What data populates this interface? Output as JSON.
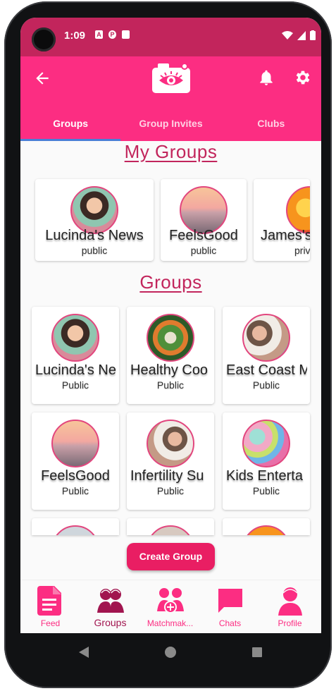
{
  "status_bar": {
    "time": "1:09",
    "icons": [
      "A",
      "P",
      "sd"
    ]
  },
  "app_bar": {
    "tabs": [
      {
        "label": "Groups",
        "active": true
      },
      {
        "label": "Group Invites",
        "active": false
      },
      {
        "label": "Clubs",
        "active": false
      }
    ]
  },
  "my_groups": {
    "title": "My Groups",
    "cards": [
      {
        "name": "Lucinda's News",
        "visibility": "public"
      },
      {
        "name": "FeelsGood",
        "visibility": "public"
      },
      {
        "name": "James's",
        "visibility": "priv"
      }
    ]
  },
  "groups": {
    "title": "Groups",
    "cards": [
      {
        "name": "Lucinda's Ne",
        "visibility": "Public"
      },
      {
        "name": "Healthy Coo",
        "visibility": "Public"
      },
      {
        "name": "East Coast M",
        "visibility": "Public"
      },
      {
        "name": "FeelsGood",
        "visibility": "Public"
      },
      {
        "name": "Infertility Su",
        "visibility": "Public"
      },
      {
        "name": "Kids Enterta",
        "visibility": "Public"
      }
    ]
  },
  "create_group_label": "Create Group",
  "bottom_nav": [
    {
      "label": "Feed",
      "active": false
    },
    {
      "label": "Groups",
      "active": true
    },
    {
      "label": "Matchmak...",
      "active": false
    },
    {
      "label": "Chats",
      "active": false
    },
    {
      "label": "Profile",
      "active": false
    }
  ],
  "colors": {
    "primary": "#fc2d82",
    "status_bar": "#c2255c",
    "accent_text": "#c2255c",
    "tab_indicator": "#4a7fd6"
  }
}
